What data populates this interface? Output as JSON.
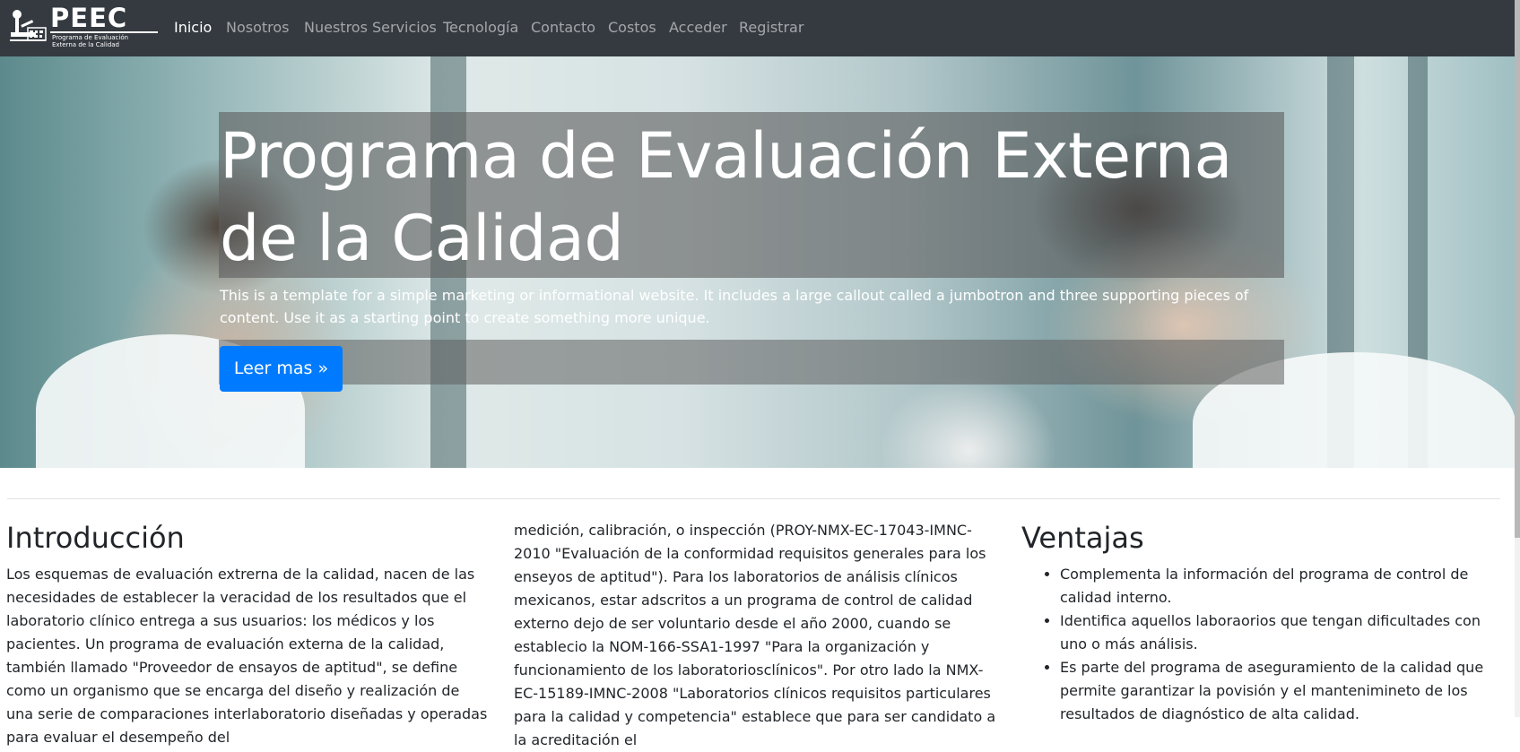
{
  "brand": {
    "name": "PEEC",
    "subtitle": "Programa de Evaluación\nExterna de la Calidad"
  },
  "nav": {
    "items": [
      "Inicio",
      "Nosotros",
      "Nuestros Servicios",
      "Tecnología",
      "Contacto",
      "Costos",
      "Acceder",
      "Registrar"
    ],
    "active": "Inicio"
  },
  "jumbotron": {
    "title": "Programa de Evaluación Externa de la Calidad",
    "lead": "This is a template for a simple marketing or informational website. It includes a large callout called a jumbotron and three supporting pieces of content. Use it as a starting point to create something more unique.",
    "button_label": "Leer mas »"
  },
  "columns": {
    "intro": {
      "heading": "Introducción",
      "text": "Los esquemas de evaluación extrerna de la calidad, nacen de las necesidades de establecer la veracidad de los resultados que el laboratorio clínico entrega a sus usuarios: los médicos y los pacientes. Un programa de evaluación externa de la calidad, también llamado \"Proveedor de ensayos de aptitud\", se define como un organismo que se encarga del diseño y realización de una serie de comparaciones interlaboratorio diseñadas y operadas para evaluar el desempeño del"
    },
    "middle": {
      "text": "medición, calibración, o inspección (PROY-NMX-EC-17043-IMNC-2010 \"Evaluación de la conformidad requisitos generales para los enseyos de aptitud\"). Para los laboratorios de análisis clínicos mexicanos, estar adscritos a un programa de control de calidad externo dejo de ser voluntario desde el año 2000, cuando se establecio la NOM-166-SSA1-1997 \"Para la organización y funcionamiento de los laboratoriosclínicos\". Por otro lado la NMX-EC-15189-IMNC-2008 \"Laboratorios clínicos requisitos particulares para la calidad y competencia\" establece que para ser candidato a la acreditación el"
    },
    "ventajas": {
      "heading": "Ventajas",
      "items": [
        "Complementa la información del programa de control de calidad interno.",
        "Identifica aquellos laboraorios que tengan dificultades con uno o más análisis.",
        "Es parte del programa de aseguramiento de la calidad que permite garantizar la povisión y el mantenimineto de los resultados de diagnóstico de alta calidad."
      ]
    }
  },
  "colors": {
    "navbar": "#343a40",
    "nav_active": "#ffffff",
    "nav_inactive": "rgba(255,255,255,0.55)",
    "button": "#007bff",
    "text": "#212529"
  }
}
